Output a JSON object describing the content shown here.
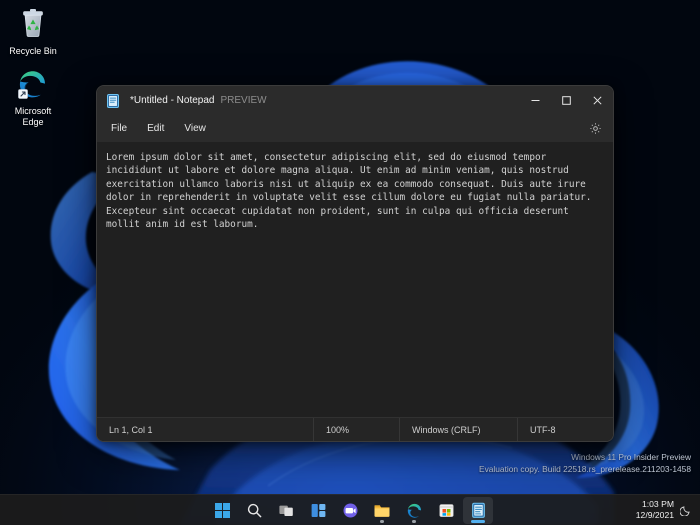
{
  "desktop": {
    "icons": [
      {
        "name": "recycle-bin",
        "label": "Recycle Bin"
      },
      {
        "name": "microsoft-edge",
        "label": "Microsoft\nEdge"
      }
    ],
    "watermark": {
      "line1": "Windows 11 Pro Insider Preview",
      "line2": "Evaluation copy. Build 22518.rs_prerelease.211203-1458"
    }
  },
  "window": {
    "icon": "notepad-icon",
    "title": "*Untitled - Notepad",
    "preview_tag": "PREVIEW",
    "controls": {
      "minimize": "minimize-button",
      "maximize": "maximize-button",
      "close": "close-button"
    },
    "menu": [
      {
        "name": "file",
        "label": "File"
      },
      {
        "name": "edit",
        "label": "Edit"
      },
      {
        "name": "view",
        "label": "View"
      }
    ],
    "settings_icon": "gear-icon",
    "editor": {
      "content": "Lorem ipsum dolor sit amet, consectetur adipiscing elit, sed do eiusmod tempor incididunt ut labore et dolore magna aliqua. Ut enim ad minim veniam, quis nostrud exercitation ullamco laboris nisi ut aliquip ex ea commodo consequat. Duis aute irure dolor in reprehenderit in voluptate velit esse cillum dolore eu fugiat nulla pariatur. Excepteur sint occaecat cupidatat non proident, sunt in culpa qui officia deserunt mollit anim id est laborum."
    },
    "statusbar": {
      "position": "Ln 1, Col 1",
      "zoom": "100%",
      "line_ending": "Windows (CRLF)",
      "encoding": "UTF-8"
    }
  },
  "taskbar": {
    "buttons": [
      {
        "name": "start",
        "label": "Start"
      },
      {
        "name": "search",
        "label": "Search"
      },
      {
        "name": "task-view",
        "label": "Task View"
      },
      {
        "name": "widgets",
        "label": "Widgets"
      },
      {
        "name": "chat",
        "label": "Chat"
      },
      {
        "name": "file-explorer",
        "label": "File Explorer"
      },
      {
        "name": "microsoft-edge",
        "label": "Microsoft Edge"
      },
      {
        "name": "microsoft-store",
        "label": "Microsoft Store"
      },
      {
        "name": "notepad",
        "label": "Notepad"
      }
    ],
    "clock": {
      "time": "1:03 PM",
      "date": "12/9/2021"
    },
    "notification_icon": "moon-icon"
  },
  "colors": {
    "accent": "#53b0ef",
    "window_chrome": "#2b2b2b",
    "editor_bg": "#202020",
    "text": "#d2d2d2",
    "desktop_bg": "#01060f"
  }
}
